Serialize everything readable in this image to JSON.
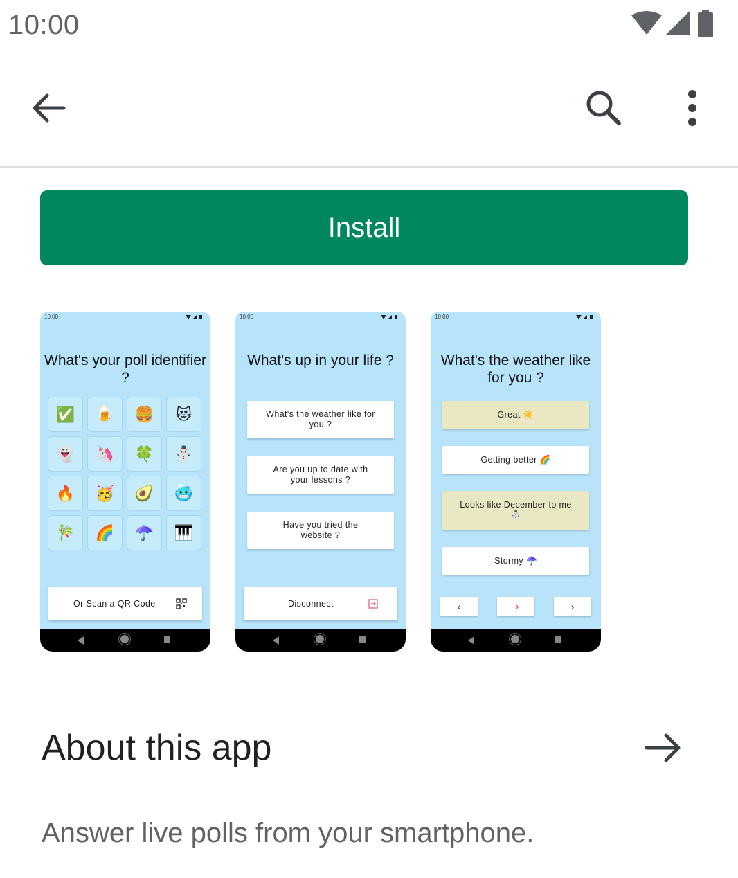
{
  "status_bar": {
    "time": "10:00",
    "icons": [
      "wifi-icon",
      "signal-icon",
      "battery-icon"
    ]
  },
  "app_bar": {
    "icons": [
      "back-arrow-icon",
      "search-icon",
      "more-vert-icon"
    ]
  },
  "install": {
    "label": "Install",
    "color": "#01875f"
  },
  "screenshots": [
    {
      "status_time": "10:00",
      "title": "What's your poll identifier ?",
      "emojis": [
        "✅",
        "🍺",
        "🍔",
        "😻",
        "👻",
        "🦄",
        "🍀",
        "⛄",
        "🔥",
        "🥳",
        "🥑",
        "🥶",
        "🎋",
        "🌈",
        "☂️",
        "🎹"
      ],
      "button": "Or Scan a QR Code"
    },
    {
      "status_time": "10:00",
      "title": "What's up in your life ?",
      "cards": [
        "What's the weather like for you ?",
        "Are you up to date with your lessons ?",
        "Have you tried the website ?"
      ],
      "button": "Disconnect"
    },
    {
      "status_time": "10:00",
      "title": "What's the weather like for you ?",
      "cards": [
        "Great ☀️",
        "Getting better 🌈",
        "Looks like December to me ⛄",
        "Stormy ☂️"
      ],
      "nav": [
        "‹",
        "⇥",
        "›"
      ]
    }
  ],
  "about": {
    "title": "About this app",
    "description": "Answer live polls from your smartphone."
  },
  "colors": {
    "screen_bg": "#b7e4fa",
    "card_yellow": "#e9e8c3"
  }
}
